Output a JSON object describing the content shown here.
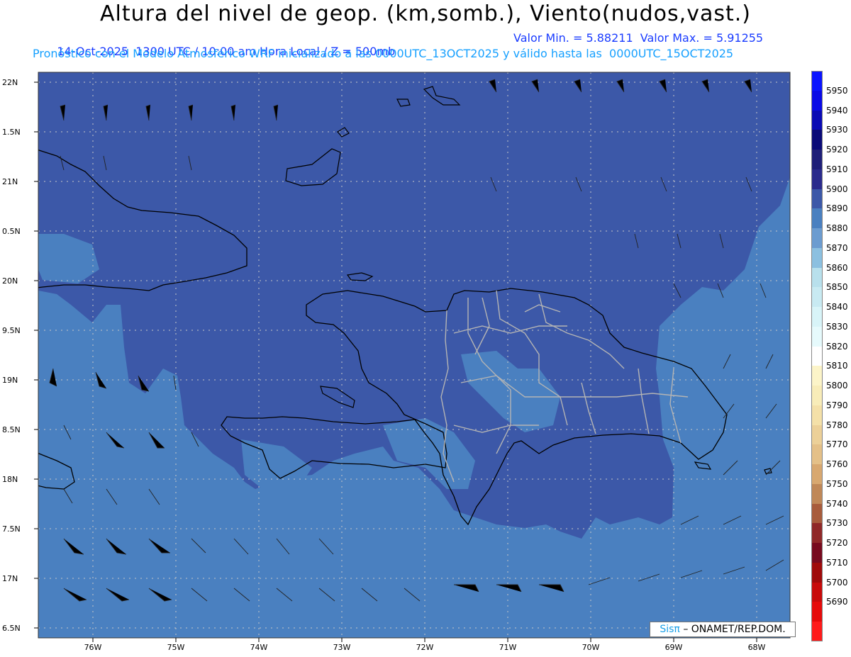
{
  "header": {
    "title": "Altura del nivel de geop. (km,somb.), Viento(nudos,vast.)",
    "subtitle_left": "14-Oct-2025  1300 UTC / 10:00 am Hora Local / Z = 500mb",
    "subtitle_right": "Valor Min. = 5.88211  Valor Max. = 5.91255",
    "model_line": "Pronóstico con el Modelo Atmosférico WRF inicializado a las 0000UTC_13OCT2025 y válido hasta las  0000UTC_15OCT2025"
  },
  "map": {
    "lat_labels": [
      "22N",
      "1.5N",
      "21N",
      "0.5N",
      "20N",
      "9.5N",
      "19N",
      "8.5N",
      "18N",
      "7.5N",
      "17N",
      "6.5N"
    ],
    "lon_labels": [
      "76W",
      "75W",
      "74W",
      "73W",
      "72W",
      "71W",
      "70W",
      "69W",
      "68W"
    ],
    "colors": {
      "level_5900": "#3c58a8",
      "level_5890": "#4a80c0",
      "level_5880": "#6c9cd0",
      "coastline": "#000000",
      "province_borders": "#b4b4b4",
      "grid": "#c8c8c8"
    }
  },
  "colorbar": {
    "levels": [
      5950,
      5940,
      5930,
      5920,
      5910,
      5900,
      5890,
      5880,
      5870,
      5860,
      5850,
      5840,
      5830,
      5820,
      5810,
      5800,
      5790,
      5780,
      5770,
      5760,
      5750,
      5740,
      5730,
      5720,
      5710,
      5700,
      5690
    ],
    "colors": [
      "#0a14ff",
      "#0a0ae6",
      "#0a0ab4",
      "#0a0a78",
      "#1e1e78",
      "#2a2a8c",
      "#3c58a8",
      "#4a80c0",
      "#6c9cd0",
      "#8cc0e0",
      "#b8e0ec",
      "#c8eaf2",
      "#d8f4f8",
      "#e6fafc",
      "#ffffff",
      "#fcf4c8",
      "#f8ecb8",
      "#f4e0a8",
      "#ecd098",
      "#e4c088",
      "#d8a870",
      "#c08858",
      "#a85c3c",
      "#902828",
      "#780a1e",
      "#a00a0a",
      "#c80a0a",
      "#e60a0a",
      "#ff1a1a"
    ]
  },
  "credit": {
    "logo": "Sisπ",
    "text": "– ONAMET/REP.DOM."
  }
}
